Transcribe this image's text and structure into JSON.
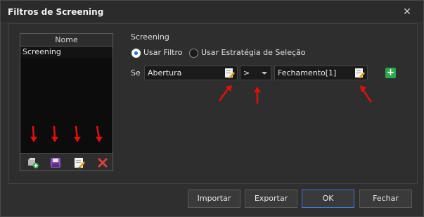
{
  "window": {
    "title": "Filtros de Screening",
    "close_glyph": "✕"
  },
  "list": {
    "header": "Nome",
    "rows": [
      "Screening"
    ]
  },
  "toolbar_icons": [
    "add-filter-icon",
    "save-icon",
    "edit-icon",
    "delete-icon"
  ],
  "screening": {
    "section_label": "Screening",
    "radio_filter": "Usar Filtro",
    "radio_strategy": "Usar Estratégia de Seleção",
    "selected": "filter"
  },
  "condition": {
    "if_label": "Se",
    "left_value": "Abertura",
    "operator": ">",
    "right_value": "Fechamento[1]",
    "add_glyph": "+"
  },
  "buttons": {
    "import": "Importar",
    "export": "Exportar",
    "ok": "OK",
    "close": "Fechar"
  },
  "colors": {
    "accent_blue": "#1a6fd6",
    "add_green": "#2aa84a",
    "arrow_red": "#e01010",
    "delete_red": "#d84040"
  }
}
